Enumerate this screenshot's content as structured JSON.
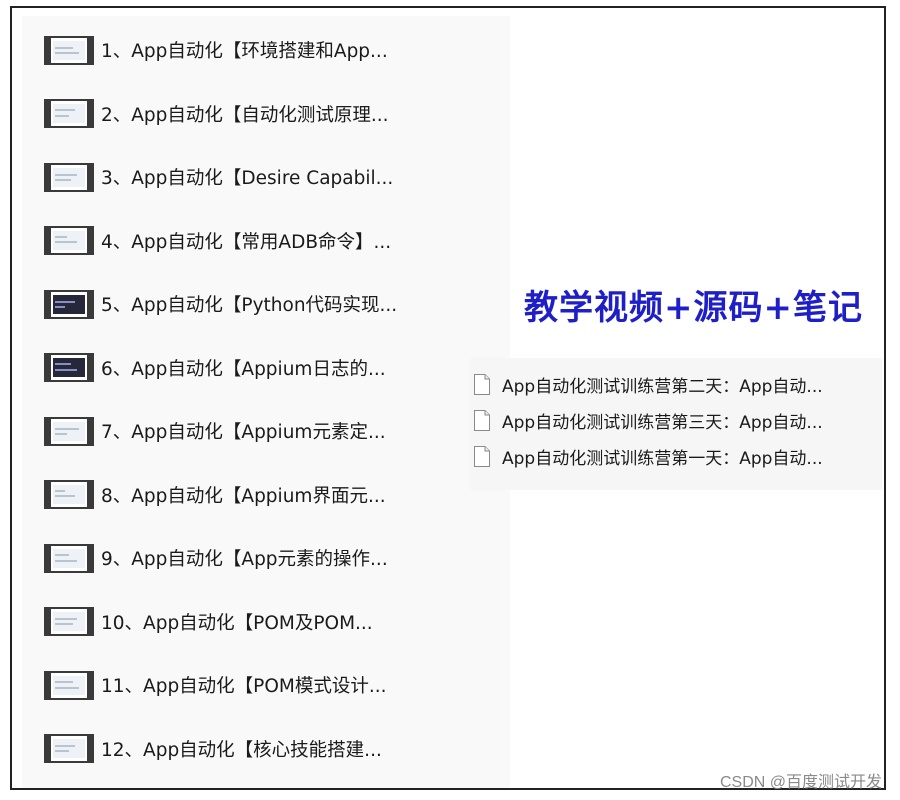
{
  "headline": "教学视频+源码+笔记",
  "videos": [
    {
      "label": "1、App自动化【环境搭建和App...",
      "icon": "video-thumbnail-icon"
    },
    {
      "label": "2、App自动化【自动化测试原理...",
      "icon": "video-thumbnail-icon"
    },
    {
      "label": "3、App自动化【Desire Capabil...",
      "icon": "video-thumbnail-icon"
    },
    {
      "label": "4、App自动化【常用ADB命令】...",
      "icon": "video-thumbnail-icon"
    },
    {
      "label": "5、App自动化【Python代码实现...",
      "icon": "video-thumbnail-icon"
    },
    {
      "label": "6、App自动化【Appium日志的...",
      "icon": "video-thumbnail-icon"
    },
    {
      "label": "7、App自动化【Appium元素定...",
      "icon": "video-thumbnail-icon"
    },
    {
      "label": "8、App自动化【Appium界面元...",
      "icon": "video-thumbnail-icon"
    },
    {
      "label": "9、App自动化【App元素的操作...",
      "icon": "video-thumbnail-icon"
    },
    {
      "label": "10、App自动化【POM及POM...",
      "icon": "video-thumbnail-icon"
    },
    {
      "label": "11、App自动化【POM模式设计...",
      "icon": "video-thumbnail-icon"
    },
    {
      "label": "12、App自动化【核心技能搭建...",
      "icon": "video-thumbnail-icon"
    }
  ],
  "files": [
    {
      "label": "App自动化测试训练营第二天：App自动...",
      "icon": "document-icon"
    },
    {
      "label": "App自动化测试训练营第三天：App自动...",
      "icon": "document-icon"
    },
    {
      "label": "App自动化测试训练营第一天：App自动...",
      "icon": "document-icon"
    }
  ],
  "watermark": "CSDN @百度测试开发",
  "colors": {
    "headline": "#1f1fc8",
    "text": "#1a1a1a",
    "watermark": "#8a8a8a"
  }
}
